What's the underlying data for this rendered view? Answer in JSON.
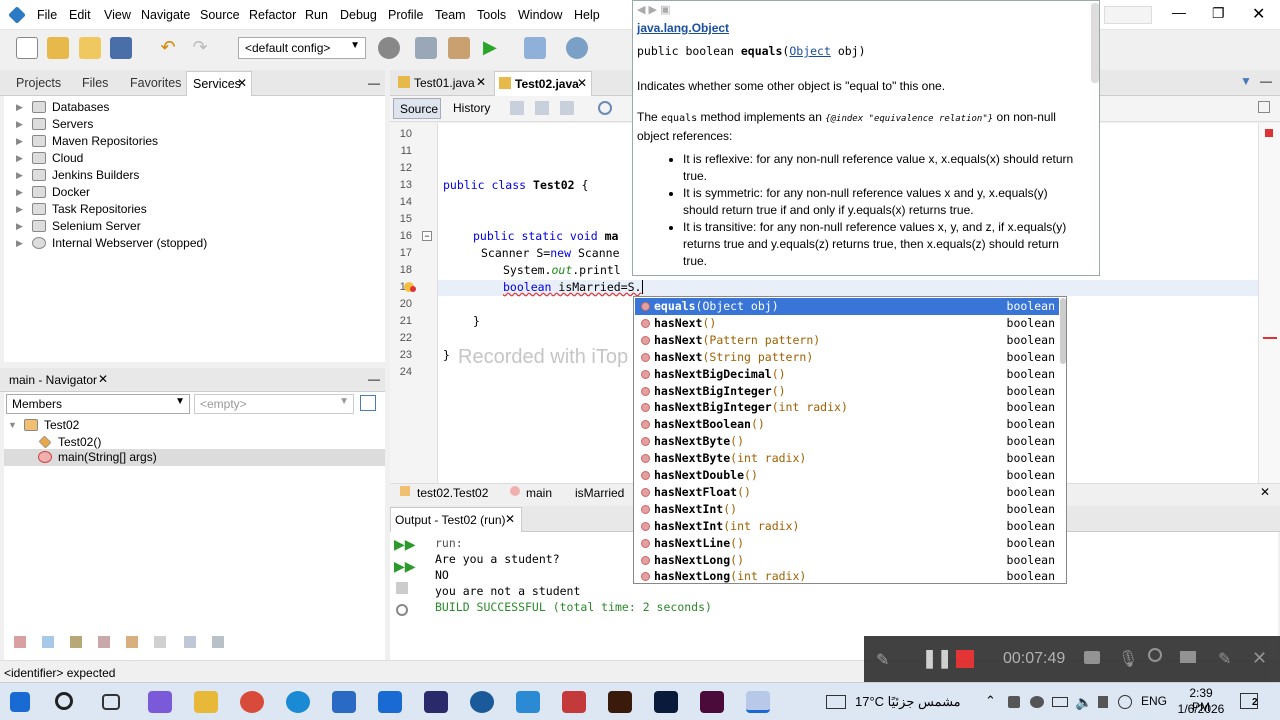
{
  "menu": [
    "File",
    "Edit",
    "View",
    "Navigate",
    "Source",
    "Refactor",
    "Run",
    "Debug",
    "Profile",
    "Team",
    "Tools",
    "Window",
    "Help"
  ],
  "toolbar": {
    "config": "<default config>"
  },
  "left_tabs": [
    "Projects",
    "Files",
    "Favorites",
    "Services"
  ],
  "services": [
    "Databases",
    "Servers",
    "Maven Repositories",
    "Cloud",
    "Jenkins Builders",
    "Docker",
    "Task Repositories",
    "Selenium Server",
    "Internal Webserver (stopped)"
  ],
  "navigator": {
    "title": "main - Navigator",
    "members": "Members",
    "empty": "<empty>",
    "items": [
      "Test02",
      "Test02()",
      "main(String[] args)"
    ]
  },
  "editor": {
    "tabs": [
      "Test01.java",
      "Test02.java"
    ],
    "source_tab": "Source",
    "history_tab": "History",
    "line_numbers": [
      "10",
      "11",
      "12",
      "13",
      "14",
      "15",
      "16",
      "17",
      "18",
      "19",
      "20",
      "21",
      "22",
      "23",
      "24"
    ],
    "breadcrumb": [
      "test02.Test02",
      "main",
      "isMarried"
    ]
  },
  "code": {
    "l13a": "public class ",
    "l13b": "Test02",
    "l13c": " {",
    "l16a": "public static void ",
    "l16b": "ma",
    "l17a": "Scanner S=",
    "l17b": "new",
    "l17c": " Scanne",
    "l18a": "System.",
    "l18b": "out",
    "l18c": ".printl",
    "l19a": "boolean",
    "l19b": " isMarried=S.",
    "l21": "}",
    "l23": "}"
  },
  "watermark": "Recorded with iTop Screen Recorder",
  "javadoc": {
    "class": "java.lang.Object",
    "sig_a": "public boolean ",
    "sig_b": "equals",
    "sig_c": "(",
    "sig_d": "Object",
    "sig_e": " obj)",
    "desc": "Indicates whether some other object is \"equal to\" this one.",
    "p1a": "The ",
    "p1b": "equals",
    "p1c": " method implements an ",
    "p1d": "{@index \"equivalence relation\"}",
    "p1e": " on non-null object references:",
    "b1": "It is reflexive: for any non-null reference value x, x.equals(x) should return true.",
    "b2": "It is symmetric: for any non-null reference values x and y, x.equals(y) should return true if and only if y.equals(x) returns true.",
    "b3": "It is transitive: for any non-null reference values x, y, and z, if x.equals(y) returns true and y.equals(z) returns true, then x.equals(z) should return true."
  },
  "completion": [
    {
      "name": "equals",
      "params": "(Object obj)",
      "type": "boolean"
    },
    {
      "name": "hasNext",
      "params": "()",
      "type": "boolean"
    },
    {
      "name": "hasNext",
      "params": "(Pattern pattern)",
      "type": "boolean"
    },
    {
      "name": "hasNext",
      "params": "(String pattern)",
      "type": "boolean"
    },
    {
      "name": "hasNextBigDecimal",
      "params": "()",
      "type": "boolean"
    },
    {
      "name": "hasNextBigInteger",
      "params": "()",
      "type": "boolean"
    },
    {
      "name": "hasNextBigInteger",
      "params": "(int radix)",
      "type": "boolean"
    },
    {
      "name": "hasNextBoolean",
      "params": "()",
      "type": "boolean"
    },
    {
      "name": "hasNextByte",
      "params": "()",
      "type": "boolean"
    },
    {
      "name": "hasNextByte",
      "params": "(int radix)",
      "type": "boolean"
    },
    {
      "name": "hasNextDouble",
      "params": "()",
      "type": "boolean"
    },
    {
      "name": "hasNextFloat",
      "params": "()",
      "type": "boolean"
    },
    {
      "name": "hasNextInt",
      "params": "()",
      "type": "boolean"
    },
    {
      "name": "hasNextInt",
      "params": "(int radix)",
      "type": "boolean"
    },
    {
      "name": "hasNextLine",
      "params": "()",
      "type": "boolean"
    },
    {
      "name": "hasNextLong",
      "params": "()",
      "type": "boolean"
    },
    {
      "name": "hasNextLong",
      "params": "(int radix)",
      "type": "boolean"
    }
  ],
  "output": {
    "title": "Output - Test02 (run)",
    "lines": [
      "run:",
      "Are you a student?",
      "NO",
      "you are not a student"
    ],
    "build": "BUILD SUCCESSFUL (total time: 2 seconds)"
  },
  "status": "<identifier> expected",
  "recorder": {
    "time": "00:07:49"
  },
  "taskbar": {
    "weather": "17°C  مشمس جزئيًا",
    "lang": "ENG",
    "time": "2:39 PM",
    "date": "1/6/2026",
    "notif": "2"
  },
  "colors": {
    "selection": "#3875d7",
    "keyword": "#0000e6",
    "success": "#2a8a2a"
  }
}
